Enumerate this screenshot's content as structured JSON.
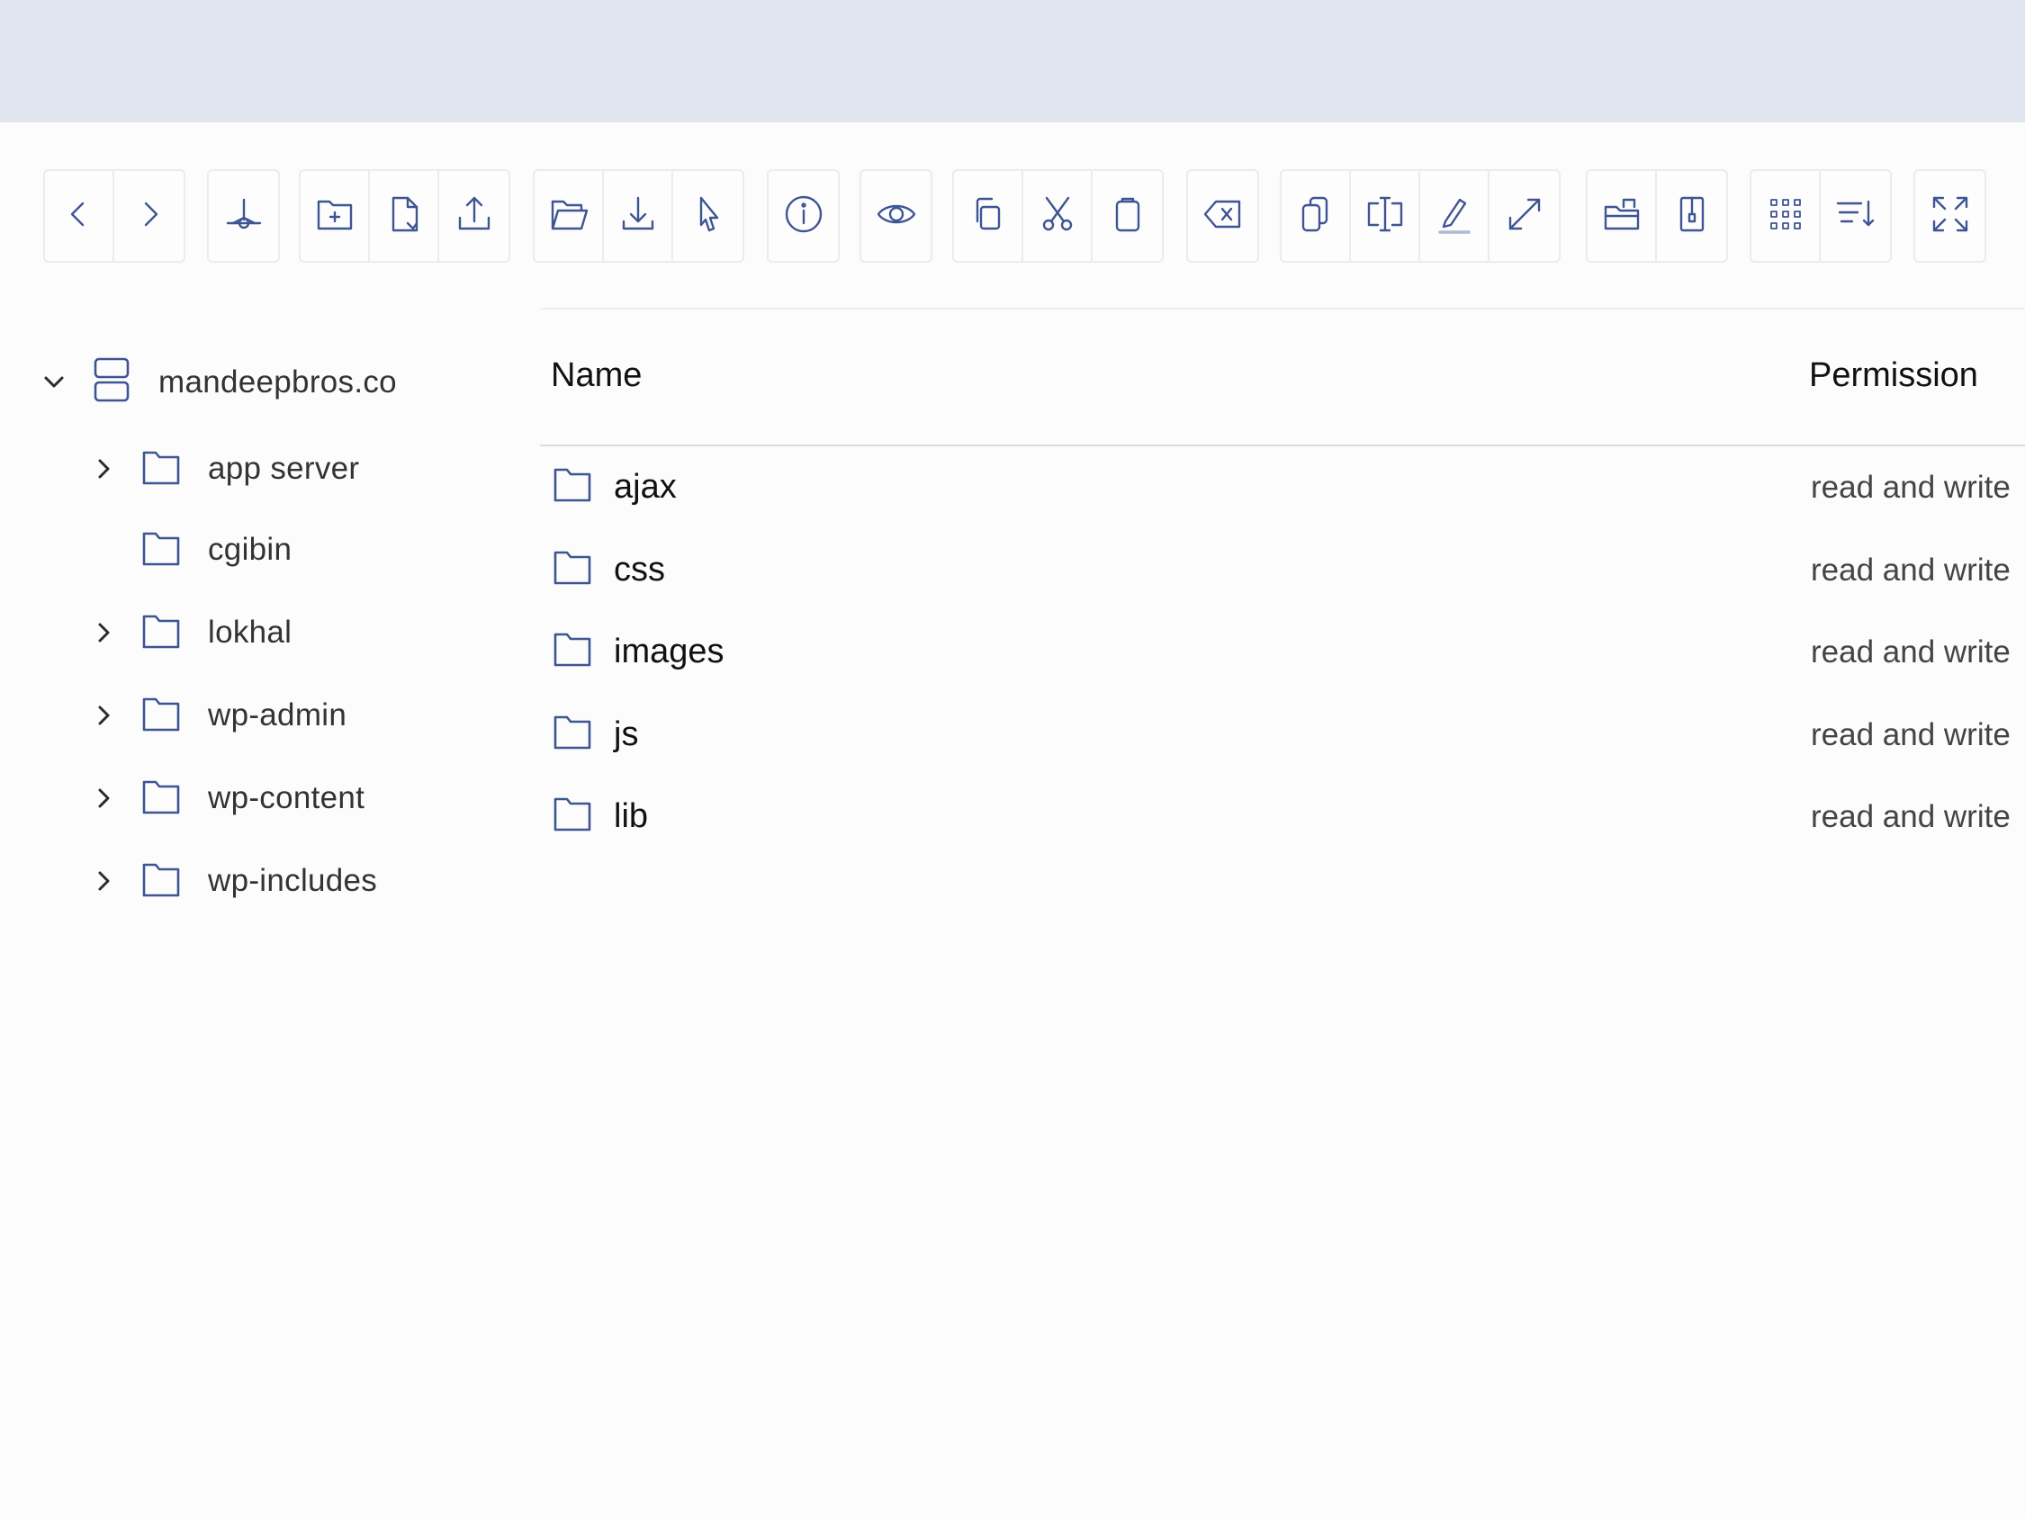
{
  "header": {
    "accent_color": "#e1e5f0"
  },
  "toolbar": {
    "groups": [
      [
        "back-icon",
        "forward-icon"
      ],
      [
        "home-icon"
      ],
      [
        "new-folder-icon",
        "new-file-icon",
        "upload-icon"
      ],
      [
        "open-icon",
        "download-icon",
        "select-icon"
      ],
      [
        "info-icon"
      ],
      [
        "preview-icon"
      ],
      [
        "copy-icon",
        "cut-icon",
        "paste-icon"
      ],
      [
        "delete-icon"
      ],
      [
        "duplicate-icon",
        "rename-icon",
        "edit-icon",
        "resize-icon"
      ],
      [
        "extract-icon",
        "archive-icon"
      ],
      [
        "grid-view-icon",
        "sort-icon"
      ],
      [
        "fullscreen-icon"
      ]
    ],
    "icon_color": "#3e5593"
  },
  "tree": {
    "root": {
      "label": "mandeepbros.co",
      "expanded": true
    },
    "items": [
      {
        "label": "app server",
        "has_children": true
      },
      {
        "label": "cgibin",
        "has_children": false
      },
      {
        "label": "lokhal",
        "has_children": true
      },
      {
        "label": "wp-admin",
        "has_children": true
      },
      {
        "label": "wp-content",
        "has_children": true
      },
      {
        "label": "wp-includes",
        "has_children": true
      }
    ]
  },
  "list": {
    "columns": {
      "name": "Name",
      "permission": "Permission"
    },
    "rows": [
      {
        "name": "ajax",
        "permission": "read and write"
      },
      {
        "name": "css",
        "permission": "read and write"
      },
      {
        "name": "images",
        "permission": "read and write"
      },
      {
        "name": "js",
        "permission": "read and write"
      },
      {
        "name": "lib",
        "permission": "read and write"
      }
    ]
  }
}
